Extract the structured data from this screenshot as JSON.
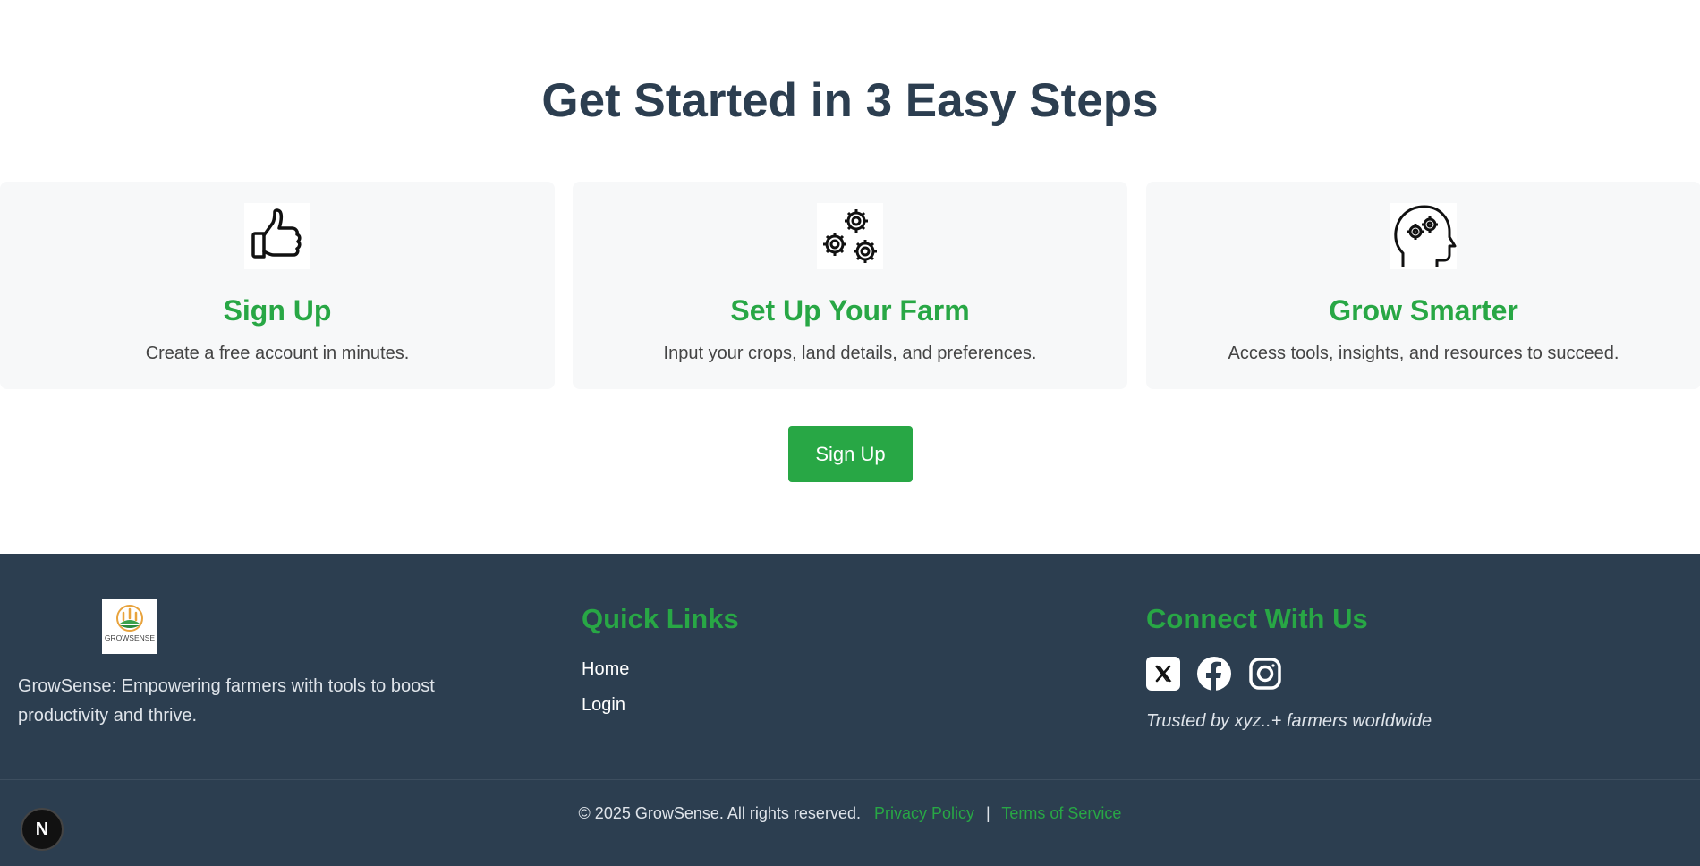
{
  "steps": {
    "title": "Get Started in 3 Easy Steps",
    "cards": [
      {
        "icon": "thumbs-up-icon",
        "title": "Sign Up",
        "description": "Create a free account in minutes."
      },
      {
        "icon": "gears-icon",
        "title": "Set Up Your Farm",
        "description": "Input your crops, land details, and preferences."
      },
      {
        "icon": "head-gears-icon",
        "title": "Grow Smarter",
        "description": "Access tools, insights, and resources to succeed."
      }
    ],
    "cta_label": "Sign Up"
  },
  "footer": {
    "logo_text": "GROWSENSE",
    "about": "GrowSense: Empowering farmers with tools to boost productivity and thrive.",
    "quick_links_heading": "Quick Links",
    "quick_links": [
      "Home",
      "Login"
    ],
    "connect_heading": "Connect With Us",
    "social": [
      "x-icon",
      "facebook-icon",
      "instagram-icon"
    ],
    "trusted": "Trusted by xyz..+ farmers worldwide",
    "copyright": "© 2025 GrowSense. All rights reserved.",
    "privacy": "Privacy Policy",
    "separator": "|",
    "terms": "Terms of Service"
  },
  "badge": {
    "label": "N"
  },
  "colors": {
    "accent": "#28a745",
    "dark": "#2c3e50",
    "card_bg": "#f7f8f9"
  }
}
